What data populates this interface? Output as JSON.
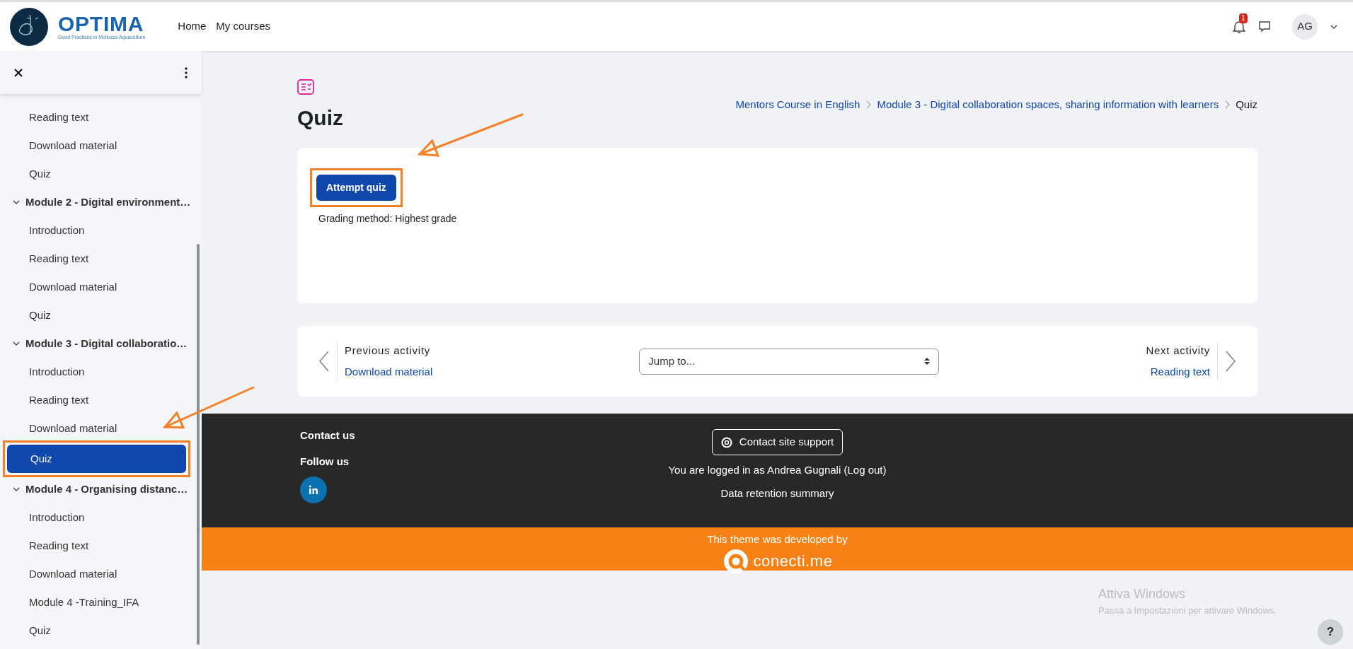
{
  "header": {
    "logo_title": "OPTIMA",
    "logo_subtitle": "Good Practices in Molluscs Aquaculture",
    "nav": [
      "Home",
      "My courses"
    ],
    "notification_count": "1",
    "avatar": "AG"
  },
  "sidebar": {
    "items": [
      {
        "kind": "activity",
        "label": "Reading text",
        "selected": false
      },
      {
        "kind": "activity",
        "label": "Download material",
        "selected": false
      },
      {
        "kind": "activity",
        "label": "Quiz",
        "selected": false
      },
      {
        "kind": "section",
        "label": "Module 2 - Digital environment…",
        "expanded": true,
        "children": [
          {
            "kind": "activity",
            "label": "Introduction",
            "selected": false
          },
          {
            "kind": "activity",
            "label": "Reading text",
            "selected": false
          },
          {
            "kind": "activity",
            "label": "Download material",
            "selected": false
          },
          {
            "kind": "activity",
            "label": "Quiz",
            "selected": false
          }
        ]
      },
      {
        "kind": "section",
        "label": "Module 3 - Digital collaboratio…",
        "expanded": true,
        "children": [
          {
            "kind": "activity",
            "label": "Introduction",
            "selected": false
          },
          {
            "kind": "activity",
            "label": "Reading text",
            "selected": false
          },
          {
            "kind": "activity",
            "label": "Download material",
            "selected": false
          },
          {
            "kind": "activity",
            "label": "Quiz",
            "selected": true
          }
        ]
      },
      {
        "kind": "section",
        "label": "Module 4 - Organising distanc…",
        "expanded": true,
        "children": [
          {
            "kind": "activity",
            "label": "Introduction",
            "selected": false
          },
          {
            "kind": "activity",
            "label": "Reading text",
            "selected": false
          },
          {
            "kind": "activity",
            "label": "Download material",
            "selected": false
          },
          {
            "kind": "activity",
            "label": "Module 4 -Training_IFA",
            "selected": false
          },
          {
            "kind": "activity",
            "label": "Quiz",
            "selected": false
          }
        ]
      }
    ]
  },
  "page": {
    "title": "Quiz",
    "breadcrumb": [
      "Mentors Course in English",
      "Module 3 - Digital collaboration spaces, sharing information with learners",
      "Quiz"
    ],
    "attempt_button": "Attempt quiz",
    "grading": "Grading method: Highest grade"
  },
  "activity_nav": {
    "previous_heading": "Previous activity",
    "previous_link": "Download material",
    "jump_placeholder": "Jump to...",
    "next_heading": "Next activity",
    "next_link": "Reading text"
  },
  "footer": {
    "contact": "Contact us",
    "follow": "Follow us",
    "support_button": "Contact site support",
    "logged_in": "You are logged in as Andrea Gugnali (Log out)",
    "data_retention": "Data retention summary",
    "credit": "This theme was developed by",
    "credit_logo": "conecti.me"
  },
  "os_notice": {
    "title": "Attiva Windows",
    "subtitle": "Passa a Impostazioni per attivare Windows."
  },
  "help_button": "?"
}
